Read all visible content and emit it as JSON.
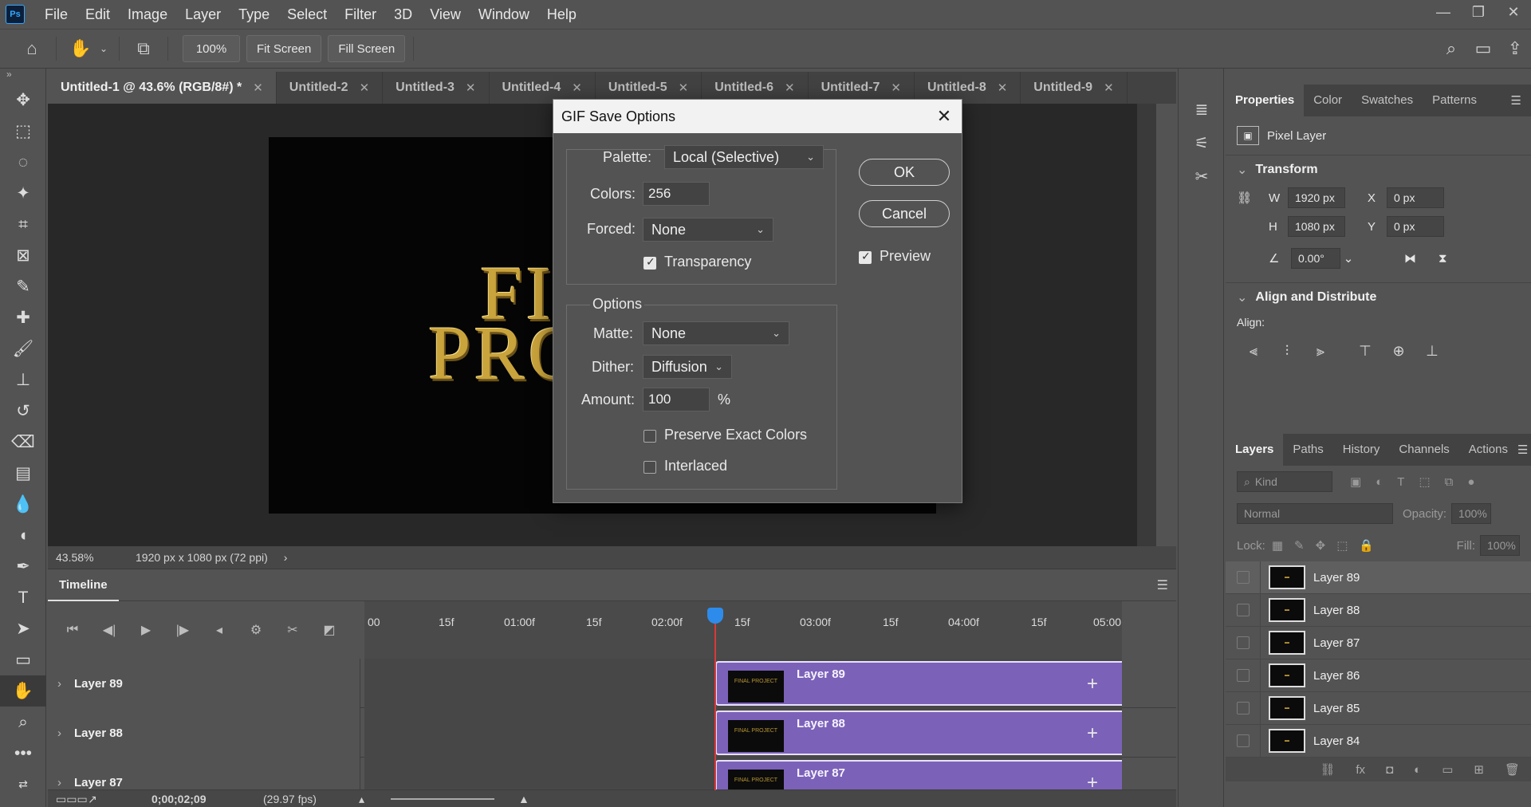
{
  "menu": [
    "File",
    "Edit",
    "Image",
    "Layer",
    "Type",
    "Select",
    "Filter",
    "3D",
    "View",
    "Window",
    "Help"
  ],
  "app_logo": "Ps",
  "options": {
    "zoom": "100%",
    "fit_screen": "Fit Screen",
    "fill_screen": "Fill Screen"
  },
  "tabs": [
    {
      "label": "Untitled-1 @ 43.6% (RGB/8#) *"
    },
    {
      "label": "Untitled-2"
    },
    {
      "label": "Untitled-3"
    },
    {
      "label": "Untitled-4"
    },
    {
      "label": "Untitled-5"
    },
    {
      "label": "Untitled-6"
    },
    {
      "label": "Untitled-7"
    },
    {
      "label": "Untitled-8"
    },
    {
      "label": "Untitled-9"
    }
  ],
  "canvas": {
    "line1": "FI",
    "line2": "PRO"
  },
  "status": {
    "zoom": "43.58%",
    "doc_info": "1920 px x 1080 px (72 ppi)"
  },
  "timeline": {
    "title": "Timeline",
    "ruler": [
      "00",
      "15f",
      "01:00f",
      "15f",
      "02:00f",
      "15f",
      "03:00f",
      "15f",
      "04:00f",
      "15f",
      "05:00"
    ],
    "rows": [
      {
        "name": "Layer 89",
        "clip": "Layer 89"
      },
      {
        "name": "Layer 88",
        "clip": "Layer 88"
      },
      {
        "name": "Layer 87",
        "clip": "Layer 87"
      }
    ],
    "thumb_text": "FINAL PROJECT",
    "timecode": "0;00;02;09",
    "fps": "(29.97 fps)"
  },
  "properties": {
    "tabs": [
      "Properties",
      "Color",
      "Swatches",
      "Patterns"
    ],
    "type": "Pixel Layer",
    "transform_title": "Transform",
    "w_label": "W",
    "w": "1920 px",
    "h_label": "H",
    "h": "1080 px",
    "x_label": "X",
    "x": "0 px",
    "y_label": "Y",
    "y": "0 px",
    "angle": "0.00°",
    "align_title": "Align and Distribute",
    "align_label": "Align:"
  },
  "layers": {
    "tabs": [
      "Layers",
      "Paths",
      "History",
      "Channels",
      "Actions"
    ],
    "kind": "Kind",
    "blend": "Normal",
    "opacity_label": "Opacity:",
    "opacity": "100%",
    "lock_label": "Lock:",
    "fill_label": "Fill:",
    "fill": "100%",
    "items": [
      "Layer 89",
      "Layer 88",
      "Layer 87",
      "Layer 86",
      "Layer 85",
      "Layer 84"
    ]
  },
  "dialog": {
    "title": "GIF Save Options",
    "palette_label": "Palette:",
    "palette": "Local (Selective)",
    "colors_label": "Colors:",
    "colors": "256",
    "forced_label": "Forced:",
    "forced": "None",
    "transparency": "Transparency",
    "options_title": "Options",
    "matte_label": "Matte:",
    "matte": "None",
    "dither_label": "Dither:",
    "dither": "Diffusion",
    "amount_label": "Amount:",
    "amount": "100",
    "percent": "%",
    "preserve": "Preserve Exact Colors",
    "interlaced": "Interlaced",
    "ok": "OK",
    "cancel": "Cancel",
    "preview": "Preview"
  }
}
